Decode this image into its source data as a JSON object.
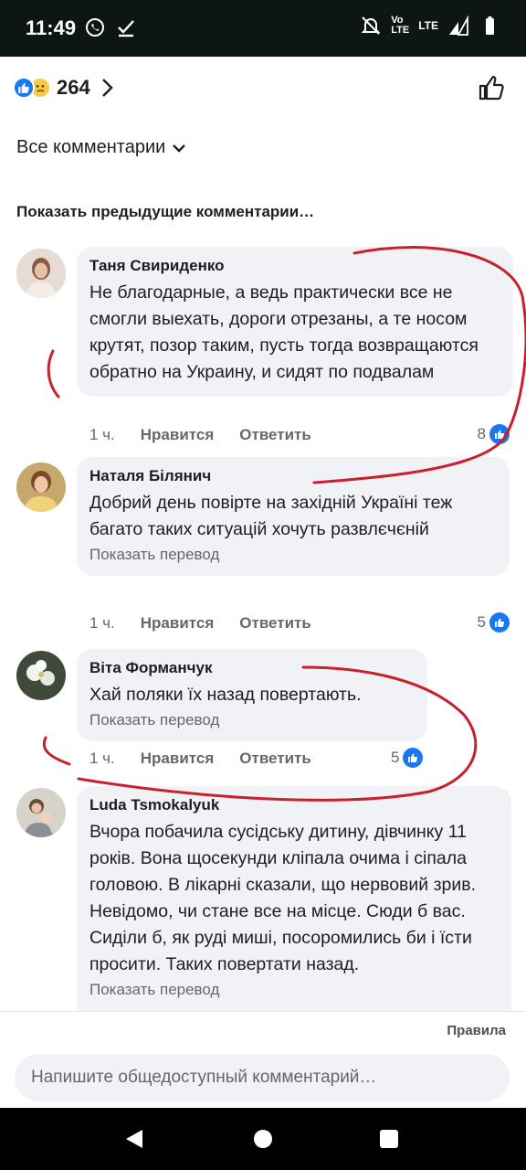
{
  "status_bar": {
    "time": "11:49",
    "network_lines": [
      "Vo",
      "LTE"
    ],
    "lte_label": "LTE",
    "icons": [
      "viber-icon",
      "check-download-icon",
      "mute-icon",
      "signal-icon",
      "battery-icon"
    ]
  },
  "reactions": {
    "count": "264",
    "types": [
      "like-icon",
      "sad-icon"
    ]
  },
  "sort": {
    "label": "Все комментарии"
  },
  "previous_comments_label": "Показать предыдущие комментарии…",
  "comments": [
    {
      "author": "Таня Свириденко",
      "text": "Не благодарные, а ведь практически все не смогли выехать, дороги отрезаны, а те носом крутят, позор таким, пусть тогда возвращаются обратно на Украину, и сидят по подвалам",
      "time": "1 ч.",
      "like_label": "Нравится",
      "reply_label": "Ответить",
      "likes": "8"
    },
    {
      "author": "Наталя Білянич",
      "text": "Добрий день повірте на західній Україні теж багато таких ситуацій хочуть развлєчєній",
      "translate_label": "Показать перевод",
      "time": "1 ч.",
      "like_label": "Нравится",
      "reply_label": "Ответить",
      "likes": "5"
    },
    {
      "author": "Віта Форманчук",
      "text": "Хай поляки їх назад повертають.",
      "translate_label": "Показать перевод",
      "time": "1 ч.",
      "like_label": "Нравится",
      "reply_label": "Ответить",
      "likes": "5"
    },
    {
      "author": "Luda Tsmokalyuk",
      "text": "Вчора побачила сусідську дитину, дівчинку 11 років. Вона щосекунди кліпала очима і сіпала головою. В лікарні сказали, що нервовий зрив. Невідомо, чи стане все на місце. Сюди б вас. Сиділи б, як руді миші, посоромились би і їсти просити. Таких повертати назад.",
      "translate_label": "Показать перевод"
    }
  ],
  "rules_label": "Правила",
  "composer": {
    "placeholder": "Напишите общедоступный комментарий…",
    "value": ""
  },
  "colors": {
    "accent": "#1877f2",
    "bubble": "#f0f2f5",
    "muted_text": "#65676b",
    "annotation": "#c8202c",
    "status_bar": "#0d1611"
  }
}
